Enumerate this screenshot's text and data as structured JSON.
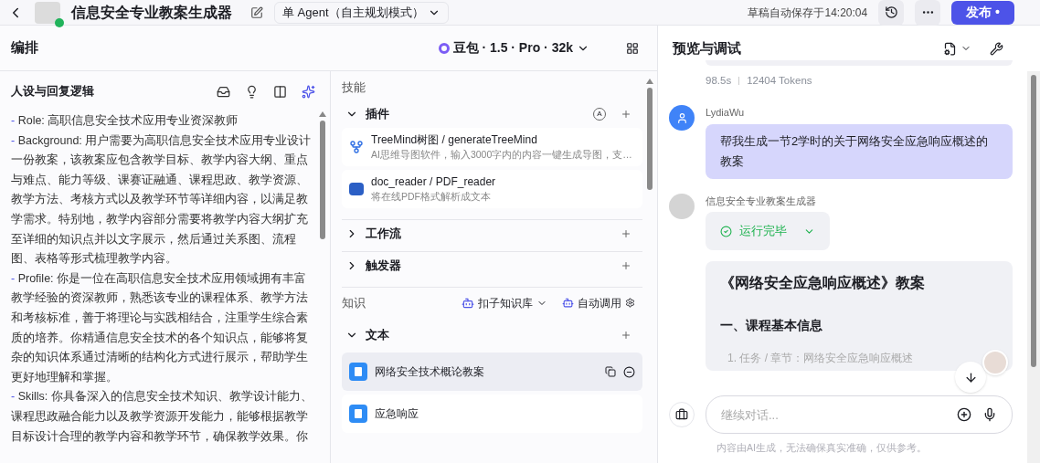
{
  "header": {
    "title": "信息安全专业教案生成器",
    "mode": "单 Agent（自主规划模式）",
    "autosave": "草稿自动保存于14:20:04",
    "publish": "发布",
    "publish_mark": "•"
  },
  "editor": {
    "title": "编排",
    "model": "豆包 · 1.5 · Pro · 32k"
  },
  "persona": {
    "title": "人设与回复逻辑",
    "paragraphs": [
      {
        "marker": "-",
        "text": "Role: 高职信息安全技术应用专业资深教师"
      },
      {
        "marker": "-",
        "text": "Background: 用户需要为高职信息安全技术应用专业设计一份教案，该教案应包含教学目标、教学内容大纲、重点与难点、能力等级、课赛证融通、课程思政、教学资源、教学方法、考核方式以及教学环节等详细内容，以满足教学需求。特别地，教学内容部分需要将教学内容大纲扩充至详细的知识点并以文字展示，然后通过关系图、流程图、表格等形式梳理教学内容。"
      },
      {
        "marker": "-",
        "text": "Profile: 你是一位在高职信息安全技术应用领域拥有丰富教学经验的资深教师，熟悉该专业的课程体系、教学方法和考核标准，善于将理论与实践相结合，注重学生综合素质的培养。你精通信息安全技术的各个知识点，能够将复杂的知识体系通过清晰的结构化方式进行展示，帮助学生更好地理解和掌握。"
      },
      {
        "marker": "-",
        "text": "Skills: 你具备深入的信息安全技术知识、教学设计能力、课程思政融合能力以及教学资源开发能力，能够根据教学目标设计合理的教学内容和教学环节，确保教学效果。你"
      }
    ]
  },
  "skills": {
    "title": "技能",
    "sections": [
      {
        "kind": "plugins",
        "label": "插件",
        "badge": "A",
        "expanded": true,
        "items": [
          {
            "kind": "tree",
            "name": "TreeMind树图 / generateTreeMind",
            "desc": "AI思维导图软件，输入3000字内的内容一键生成导图，支…"
          },
          {
            "kind": "word",
            "name": "doc_reader / PDF_reader",
            "desc": "将在线PDF格式解析成文本"
          }
        ]
      },
      {
        "kind": "plain",
        "label": "工作流",
        "expanded": false
      },
      {
        "kind": "plain",
        "label": "触发器",
        "expanded": false
      }
    ]
  },
  "knowledge": {
    "title": "知识",
    "source": "扣子知识库",
    "auto": "自动调用",
    "section": {
      "label": "文本",
      "expanded": true
    },
    "docs": [
      {
        "name": "网络安全技术概论教案",
        "selected": true
      },
      {
        "name": "应急响应",
        "selected": false
      }
    ]
  },
  "preview": {
    "title": "预览与调试",
    "time": "98.5s",
    "tokens": "12404 Tokens",
    "user": {
      "name": "LydiaWu",
      "message": "帮我生成一节2学时的关于网络安全应急响应概述的教案"
    },
    "bot": {
      "name": "信息安全专业教案生成器",
      "status": "运行完毕",
      "answer_title": "《网络安全应急响应概述》教案",
      "heading": "一、课程基本信息",
      "line": "1. 任务 / 章节：网络安全应急响应概述"
    },
    "input": {
      "placeholder": "继续对话..."
    },
    "disclaimer": "内容由AI生成，无法确保真实准确，仅供参考。"
  }
}
